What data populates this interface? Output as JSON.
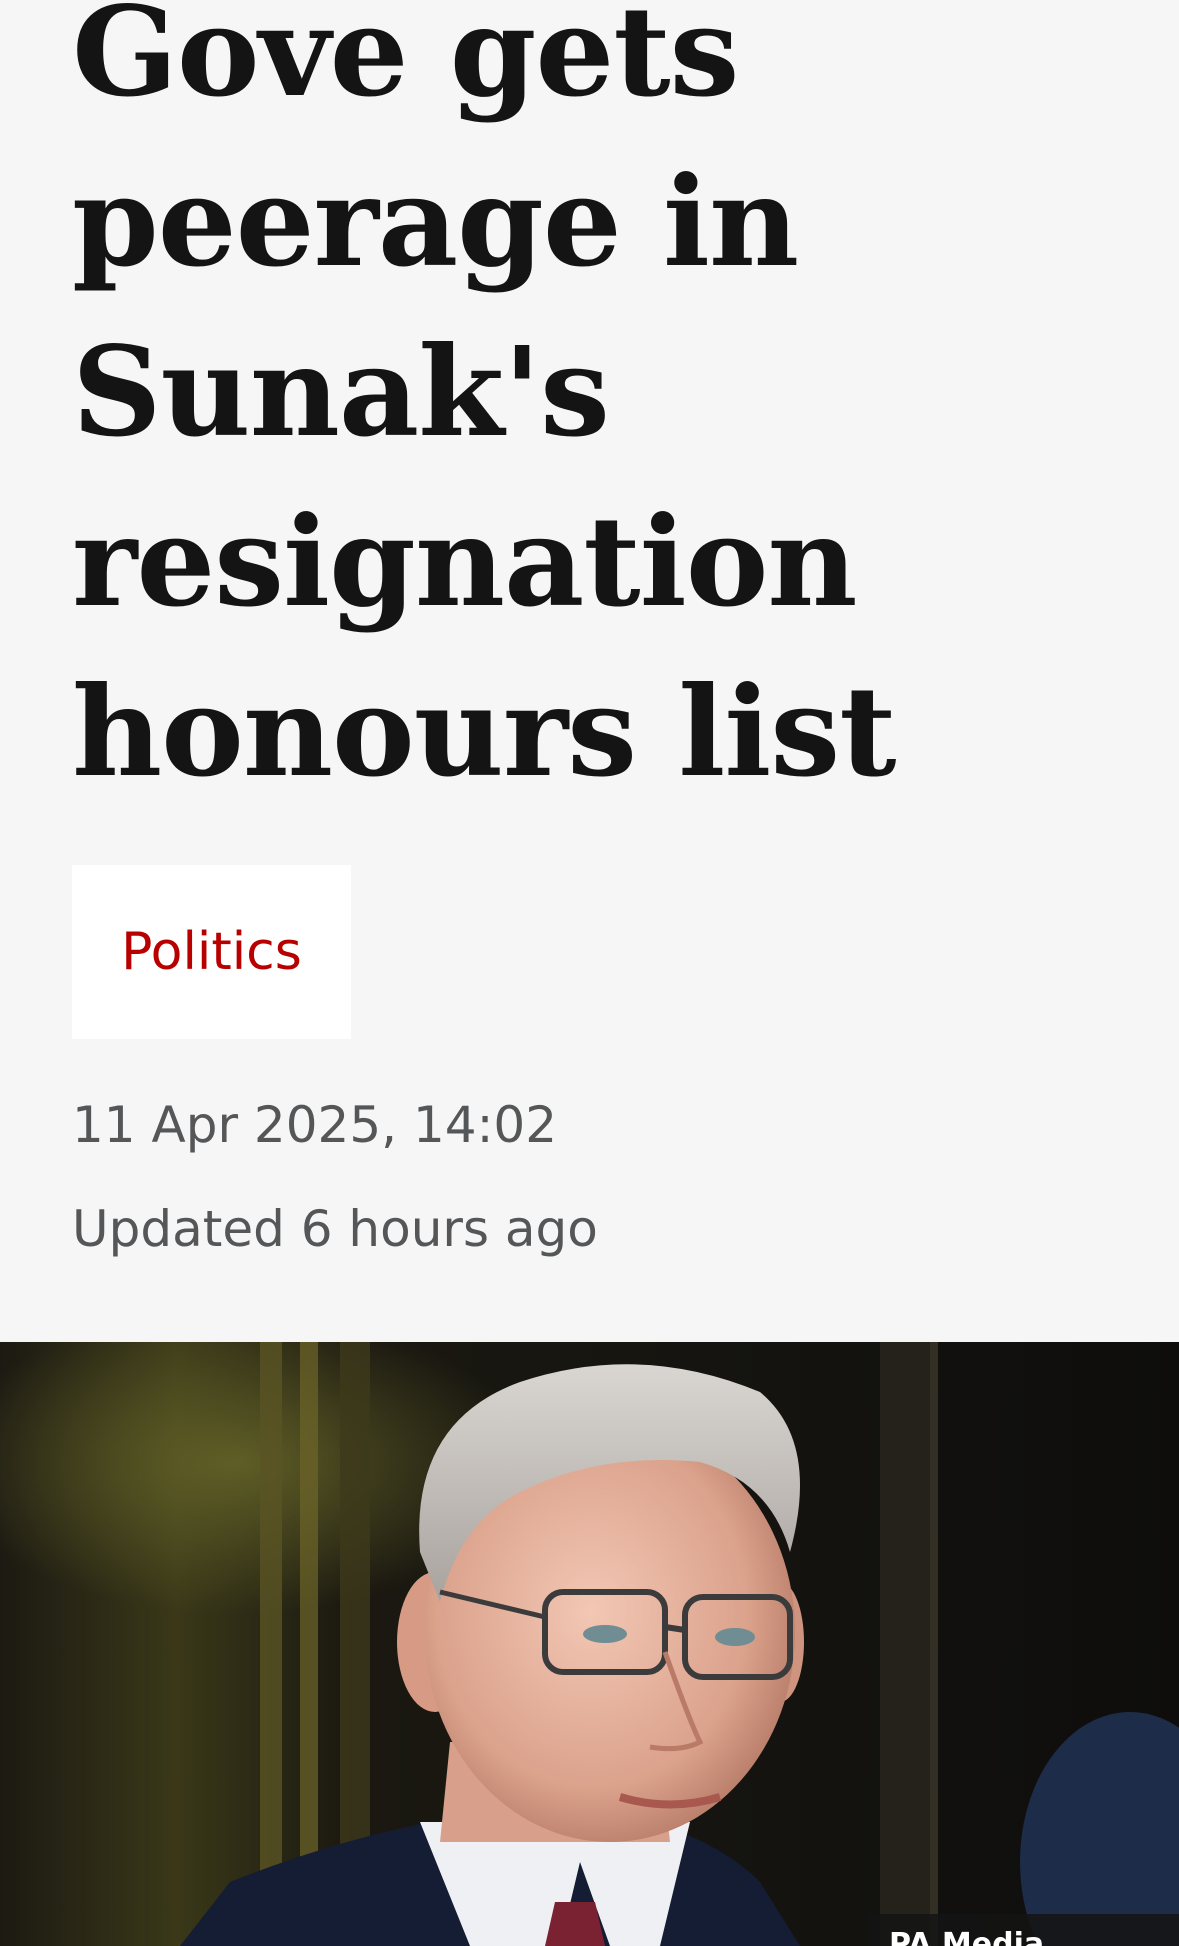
{
  "article": {
    "headline_lines": [
      "Gove gets",
      "peerage in",
      "Sunak's",
      "resignation",
      "honours list"
    ],
    "topic_label": "Politics",
    "timestamp": "11 Apr 2025, 14:02",
    "updated": "Updated 6 hours ago"
  },
  "hero_image": {
    "alt": "Michael Gove",
    "credit": "PA Media"
  },
  "colors": {
    "background": "#f6f6f6",
    "headline": "#141414",
    "topic": "#b80000",
    "meta_text": "#545658"
  }
}
